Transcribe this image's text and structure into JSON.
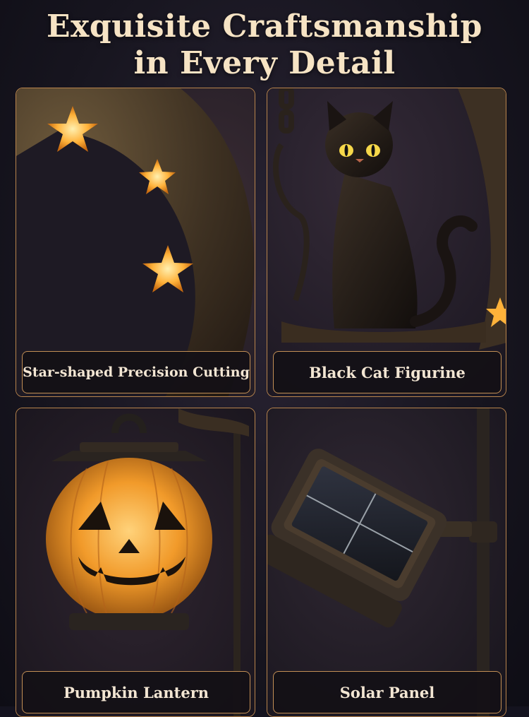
{
  "headline": {
    "line1": "Exquisite Craftsmanship",
    "line2": "in Every Detail"
  },
  "features": [
    {
      "label": "Star-shaped Precision Cutting",
      "icon": "star-cutout-moon"
    },
    {
      "label": "Black Cat Figurine",
      "icon": "black-cat"
    },
    {
      "label": "Pumpkin Lantern",
      "icon": "jack-o-lantern"
    },
    {
      "label": "Solar Panel",
      "icon": "solar-panel"
    }
  ],
  "colors": {
    "background": "#17151f",
    "border": "#b8844c",
    "text": "#f6e3c4",
    "glow": "#ffb23a"
  }
}
